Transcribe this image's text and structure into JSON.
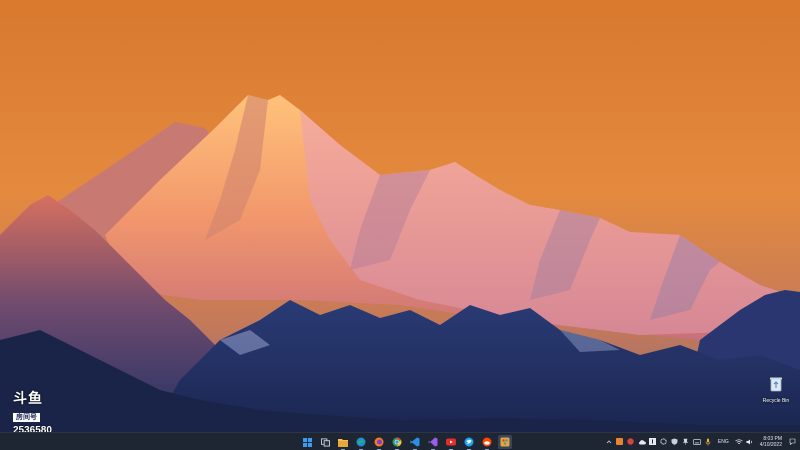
{
  "desktop": {
    "recycle_bin_label": "Recycle Bin"
  },
  "watermark": {
    "brand_text": "斗鱼",
    "room_label": "房间号",
    "room_number": "2536580"
  },
  "taskbar": {
    "apps": [
      {
        "icon": "windows-start-icon",
        "color": "#3b9df0"
      },
      {
        "icon": "task-view-icon",
        "color": "#c9d0da"
      },
      {
        "icon": "file-explorer-icon",
        "color": "#f2c14e"
      },
      {
        "icon": "edge-icon",
        "color": "#2fb36b"
      },
      {
        "icon": "firefox-icon",
        "color": "#ff7a1a"
      },
      {
        "icon": "chrome-icon",
        "color": "#4a90e2"
      },
      {
        "icon": "vscode-icon",
        "color": "#2d8fe0"
      },
      {
        "icon": "visual-studio-icon",
        "color": "#9b5de5"
      },
      {
        "icon": "youtube-icon",
        "color": "#e52d27"
      },
      {
        "icon": "twitter-icon",
        "color": "#1da1f2"
      },
      {
        "icon": "reddit-icon",
        "color": "#ff4500"
      },
      {
        "icon": "paint-icon",
        "color": "#e8a33c"
      }
    ],
    "tray": {
      "language": "ENG",
      "time": "8:03 PM",
      "date": "4/10/2022"
    }
  }
}
